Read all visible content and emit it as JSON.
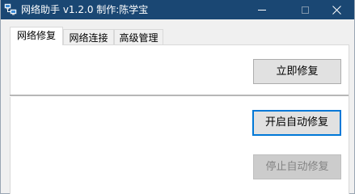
{
  "window": {
    "title": "网络助手 v1.2.0 制作:陈学宝",
    "app_icon": "network-computers-icon",
    "controls": {
      "minimize": "minimize-icon",
      "maximize": "maximize-icon",
      "close": "close-icon"
    }
  },
  "tabs": [
    {
      "label": "网络修复",
      "active": true
    },
    {
      "label": "网络连接",
      "active": false
    },
    {
      "label": "高级管理",
      "active": false
    }
  ],
  "buttons": {
    "repair_now": "立即修复",
    "start_auto_repair": "开启自动修复",
    "stop_auto_repair": "停止自动修复"
  },
  "states": {
    "stop_auto_repair_enabled": false,
    "start_auto_repair_focused": true
  },
  "colors": {
    "titlebar": "#1a4773",
    "focus_border": "#0078d7",
    "disabled_text": "#838383"
  }
}
